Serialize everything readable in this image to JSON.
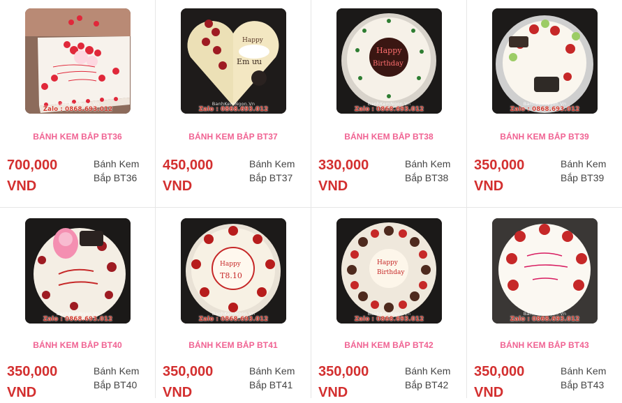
{
  "products": [
    {
      "name": "BÁNH KEM BẮP BT36",
      "price": "700,000",
      "currency": "VND",
      "alt_line1": "Bánh Kem",
      "alt_line2": "Bắp BT36",
      "watermark": "Zalo : 0868.693.012",
      "site": "BanhKemNgon.Vn",
      "icon": "square-cake-hearts-image"
    },
    {
      "name": "BÁNH KEM BẮP BT37",
      "price": "450,000",
      "currency": "VND",
      "alt_line1": "Bánh Kem",
      "alt_line2": "Bắp BT37",
      "watermark": "Zalo : 0868.693.012",
      "site": "BanhKemNgon.Vn",
      "icon": "heart-cake-strawberry-image"
    },
    {
      "name": "BÁNH KEM BẮP BT38",
      "price": "330,000",
      "currency": "VND",
      "alt_line1": "Bánh Kem",
      "alt_line2": "Bắp BT38",
      "watermark": "Zalo : 0868.693.012",
      "site": "BanhKemNgon.Vn",
      "icon": "round-cake-happy-birthday-image"
    },
    {
      "name": "BÁNH KEM BẮP BT39",
      "price": "350,000",
      "currency": "VND",
      "alt_line1": "Bánh Kem",
      "alt_line2": "Bắp BT39",
      "watermark": "Zalo : 0868.693.012",
      "site": "BanhKemNgon.Vn",
      "icon": "round-cake-fruit-image"
    },
    {
      "name": "BÁNH KEM BẮP BT40",
      "price": "350,000",
      "currency": "VND",
      "alt_line1": "Bánh Kem",
      "alt_line2": "Bắp BT40",
      "watermark": "Zalo : 0868.693.012",
      "site": "BanhKemNgon.Vn",
      "icon": "round-cake-pig-image"
    },
    {
      "name": "BÁNH KEM BẮP BT41",
      "price": "350,000",
      "currency": "VND",
      "alt_line1": "Bánh Kem",
      "alt_line2": "Bắp BT41",
      "watermark": "Zalo : 0868.693.012",
      "site": "BanhKemNgon.Vn",
      "icon": "round-cake-strawberry-image"
    },
    {
      "name": "BÁNH KEM BẮP BT42",
      "price": "350,000",
      "currency": "VND",
      "alt_line1": "Bánh Kem",
      "alt_line2": "Bắp BT42",
      "watermark": "Zalo : 0868.693.012",
      "site": "BanhKemNgon.Vn",
      "icon": "round-cake-chocolate-strawberry-image"
    },
    {
      "name": "BÁNH KEM BẮP BT43",
      "price": "350,000",
      "currency": "VND",
      "alt_line1": "Bánh Kem",
      "alt_line2": "Bắp BT43",
      "watermark": "Zalo : 0868.693.012",
      "site": "BanhKemNgon.Vn",
      "icon": "round-cake-ms-tuong-image"
    }
  ],
  "colors": {
    "name": "#f06292",
    "price": "#d32f2f",
    "alt_text": "#444444",
    "divider": "#e6e6e6"
  }
}
